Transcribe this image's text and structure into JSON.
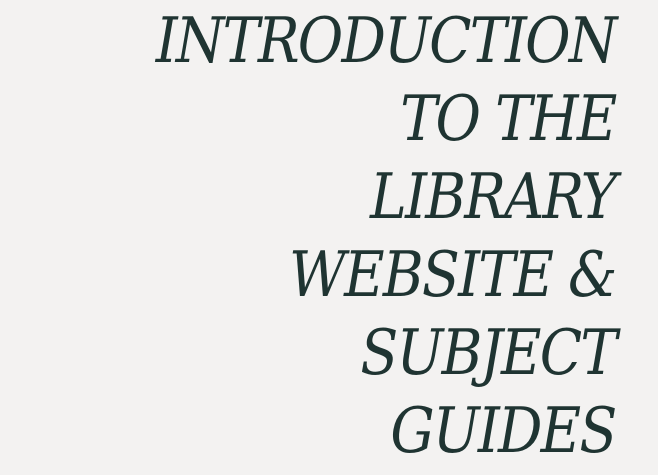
{
  "slide": {
    "title_lines": [
      "INTRODUCTION",
      "TO THE",
      "LIBRARY",
      "WEBSITE &",
      "SUBJECT",
      "GUIDES"
    ],
    "colors": {
      "background": "#f3f2f1",
      "title_text": "#1f3432"
    }
  }
}
